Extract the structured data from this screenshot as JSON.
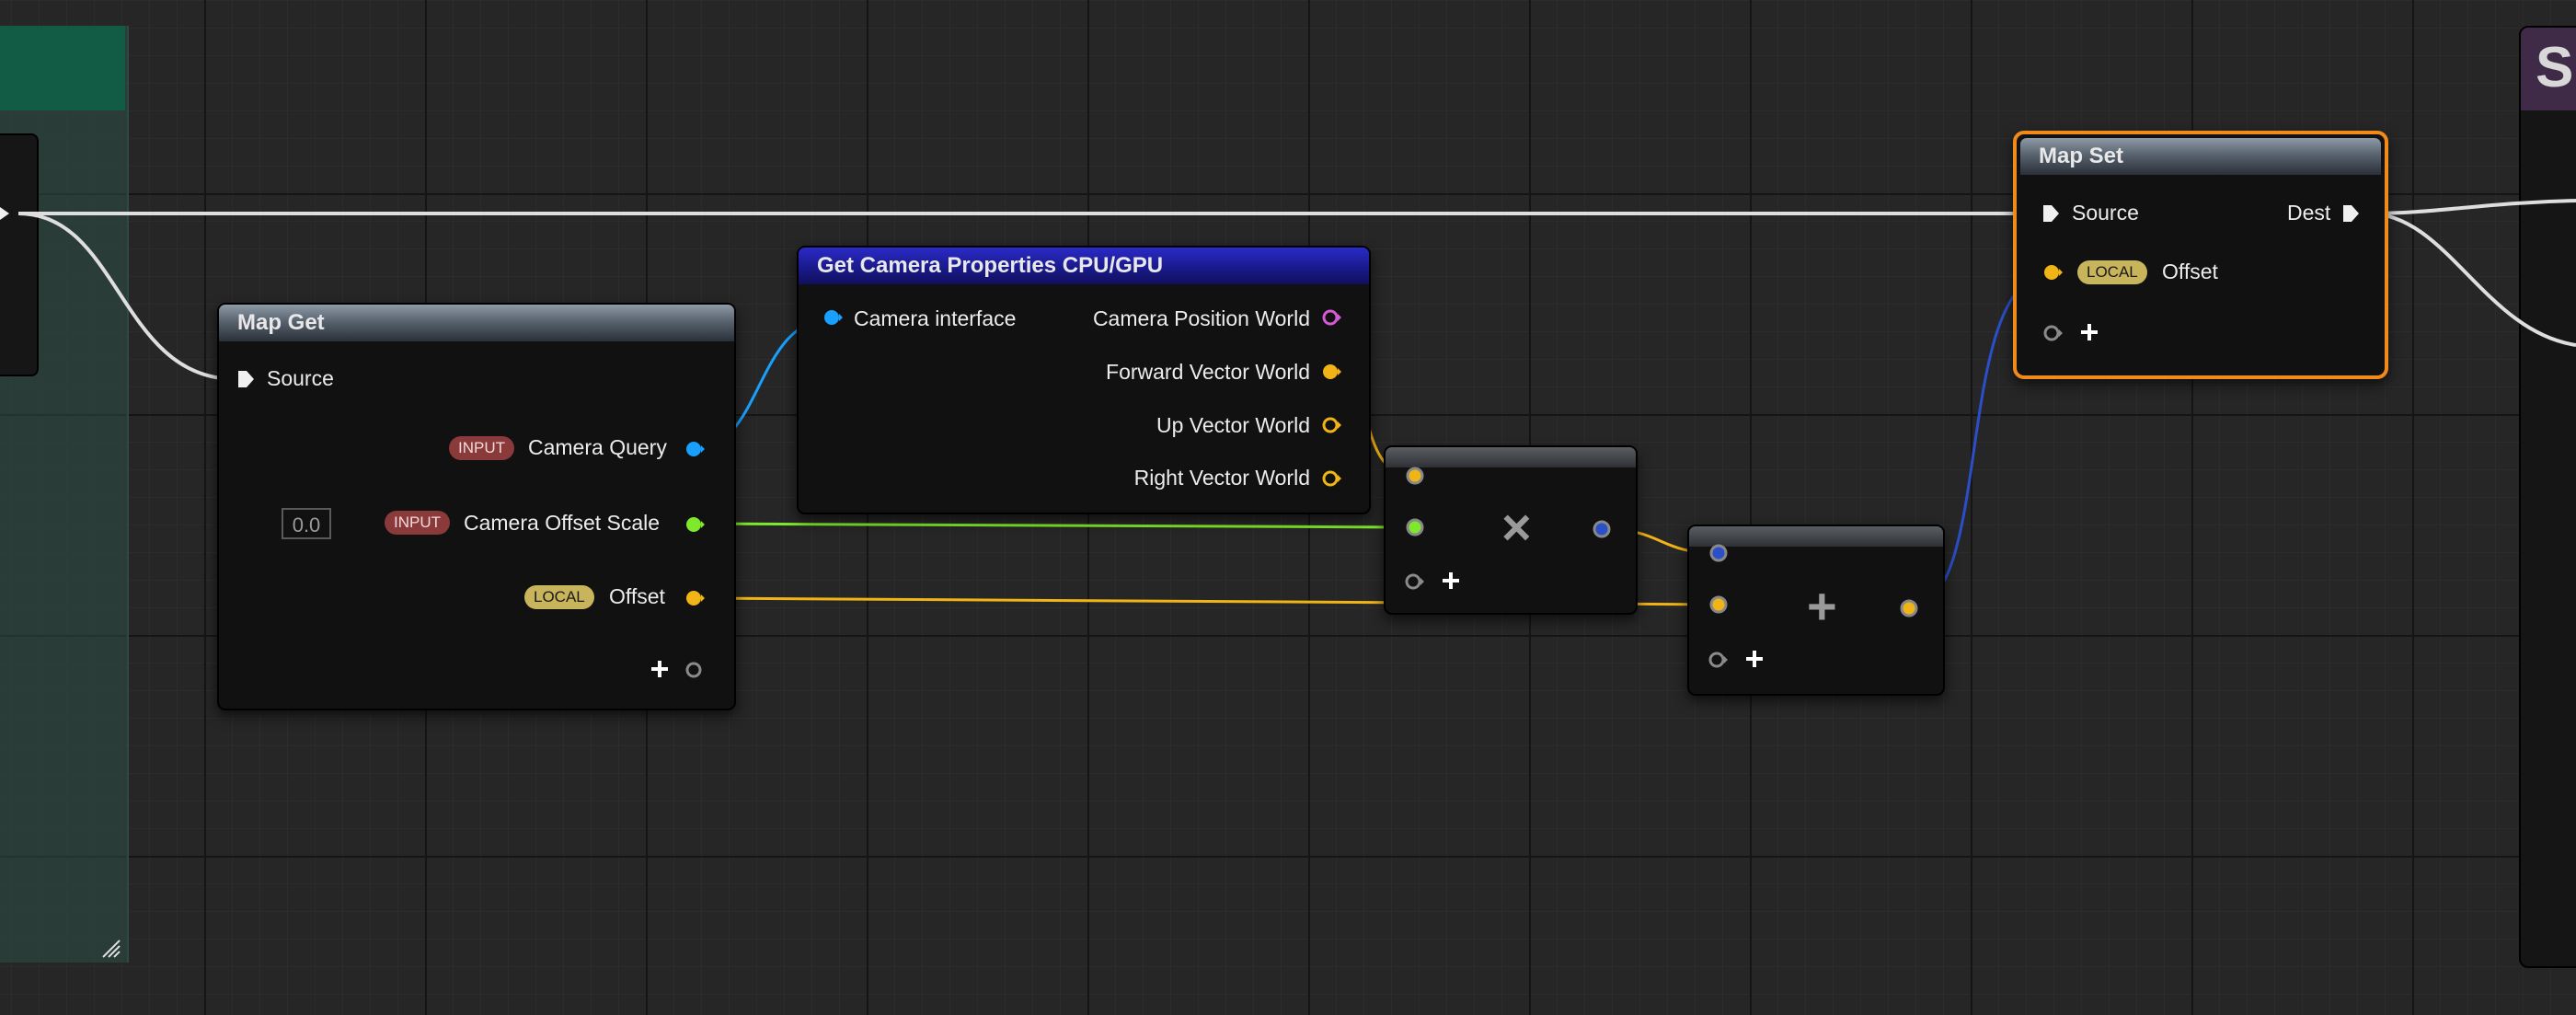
{
  "colors": {
    "exec": "#e0e0e0",
    "camera_interface": "#19a0ff",
    "float": "#7ee82a",
    "vector": "#f0b416",
    "position": "#d55ad5",
    "blue_output": "#2a4fc8",
    "selection": "#f08b1a"
  },
  "right_node": {
    "letter": "S"
  },
  "map_get": {
    "title": "Map Get",
    "source_label": "Source",
    "camera_query_badge": "INPUT",
    "camera_query_label": "Camera Query",
    "offset_scale_value": "0.0",
    "offset_scale_badge": "INPUT",
    "offset_scale_label": "Camera Offset Scale",
    "offset_badge": "LOCAL",
    "offset_label": "Offset",
    "add_pin_icon": "plus-icon"
  },
  "camera_props": {
    "title": "Get Camera Properties CPU/GPU",
    "input_label": "Camera interface",
    "outputs": [
      "Camera Position World",
      "Forward Vector World",
      "Up Vector World",
      "Right Vector World"
    ]
  },
  "multiply_node": {
    "symbol": "×",
    "add_pin_icon": "plus-icon"
  },
  "add_node": {
    "symbol": "+",
    "add_pin_icon": "plus-icon"
  },
  "map_set": {
    "title": "Map Set",
    "source_label": "Source",
    "dest_label": "Dest",
    "offset_badge": "LOCAL",
    "offset_label": "Offset",
    "add_pin_icon": "plus-icon"
  }
}
